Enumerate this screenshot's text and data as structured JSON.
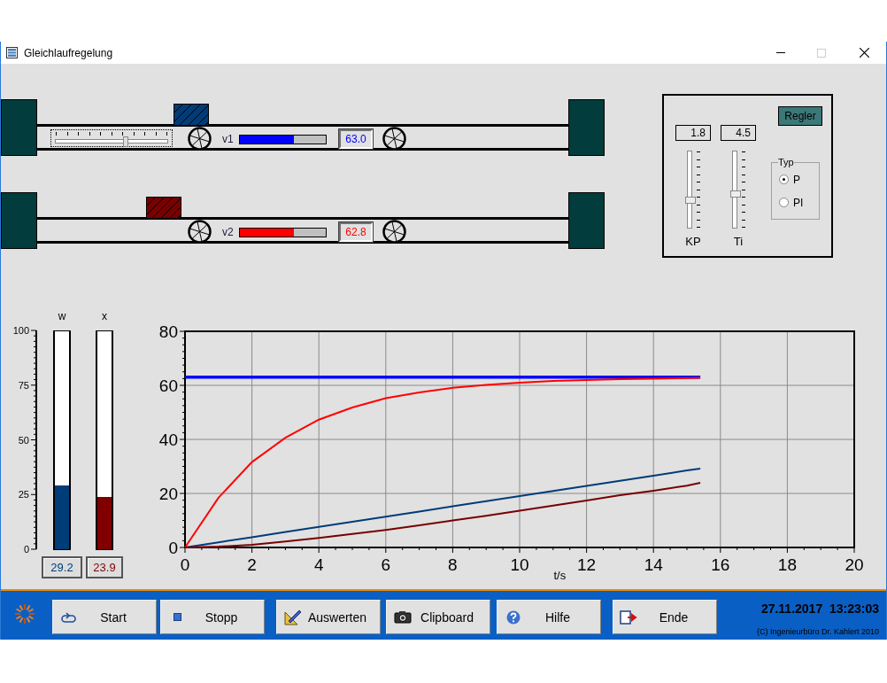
{
  "window": {
    "title": "Gleichlaufregelung"
  },
  "conveyors": [
    {
      "label": "v1",
      "box": {
        "level": 0.292,
        "color": "#003c78"
      },
      "slider": {
        "level": 0.64
      },
      "speed": {
        "level": 0.63,
        "color": "#0000ff"
      },
      "reading": "63.0"
    },
    {
      "label": "v2",
      "box": {
        "level": 0.239,
        "color": "#780000"
      },
      "speed": {
        "level": 0.628,
        "color": "#ff0000"
      },
      "reading": "62.8"
    }
  ],
  "controller": {
    "button": "Regler",
    "parameters": [
      {
        "value": "1.8",
        "level": 0.35,
        "label": "KP"
      },
      {
        "value": "4.5",
        "level": 0.44,
        "label": "Ti"
      }
    ],
    "type_group": {
      "title": "Typ",
      "options": [
        {
          "label": "P",
          "selected": true
        },
        {
          "label": "PI",
          "selected": false
        }
      ]
    }
  },
  "gauges": {
    "scale": [
      "100",
      "75",
      "50",
      "25",
      "0"
    ],
    "bars": [
      {
        "label": "w",
        "level": 0.292,
        "reading": "29.2",
        "color": "#003c78"
      },
      {
        "label": "x",
        "level": 0.239,
        "reading": "23.9",
        "color": "#800000"
      }
    ]
  },
  "chart": {
    "chart_data": {
      "type": "line",
      "xlabel": "t/s",
      "x": [
        0,
        1,
        2,
        3,
        4,
        5,
        6,
        7,
        8,
        9,
        10,
        11,
        12,
        13,
        14,
        15,
        15.4
      ],
      "series": [
        {
          "color": "#0000ff",
          "values": [
            63,
            63,
            63,
            63,
            63,
            63,
            63,
            63,
            63,
            63,
            63,
            63,
            63,
            63,
            63,
            63,
            63
          ]
        },
        {
          "color": "#ff0000",
          "values": [
            0,
            18.4,
            31.6,
            40.6,
            47.3,
            51.8,
            55.2,
            57.4,
            59.1,
            60.2,
            61.0,
            61.6,
            62.0,
            62.3,
            62.5,
            62.7,
            62.8
          ]
        },
        {
          "color": "#003c78",
          "values": [
            0,
            1.9,
            3.8,
            5.7,
            7.6,
            9.5,
            11.4,
            13.3,
            15.2,
            17.1,
            19,
            20.9,
            22.8,
            24.7,
            26.6,
            28.5,
            29.2
          ]
        },
        {
          "color": "#780000",
          "values": [
            0,
            0.3,
            1,
            2.2,
            3.5,
            5,
            6.5,
            8.2,
            10,
            11.7,
            13.6,
            15.5,
            17.4,
            19.3,
            21,
            22.9,
            23.9
          ]
        }
      ],
      "xlim": [
        0,
        20
      ],
      "ylim": [
        0,
        80
      ],
      "xticks": [
        0,
        2,
        4,
        6,
        8,
        10,
        12,
        14,
        16,
        18,
        20
      ],
      "yticks": [
        0,
        20,
        40,
        60,
        80
      ],
      "grid": true
    }
  },
  "toolbar": {
    "buttons": [
      {
        "label": "Start"
      },
      {
        "label": "Stopp"
      },
      {
        "label": "Auswerten"
      },
      {
        "label": "Clipboard"
      },
      {
        "label": "Hilfe"
      },
      {
        "label": "Ende"
      }
    ]
  },
  "status": {
    "datetime": "27.11.2017  13:23:03",
    "copyright": "(C) Ingenieurbüro Dr. Kahlert 2010"
  }
}
